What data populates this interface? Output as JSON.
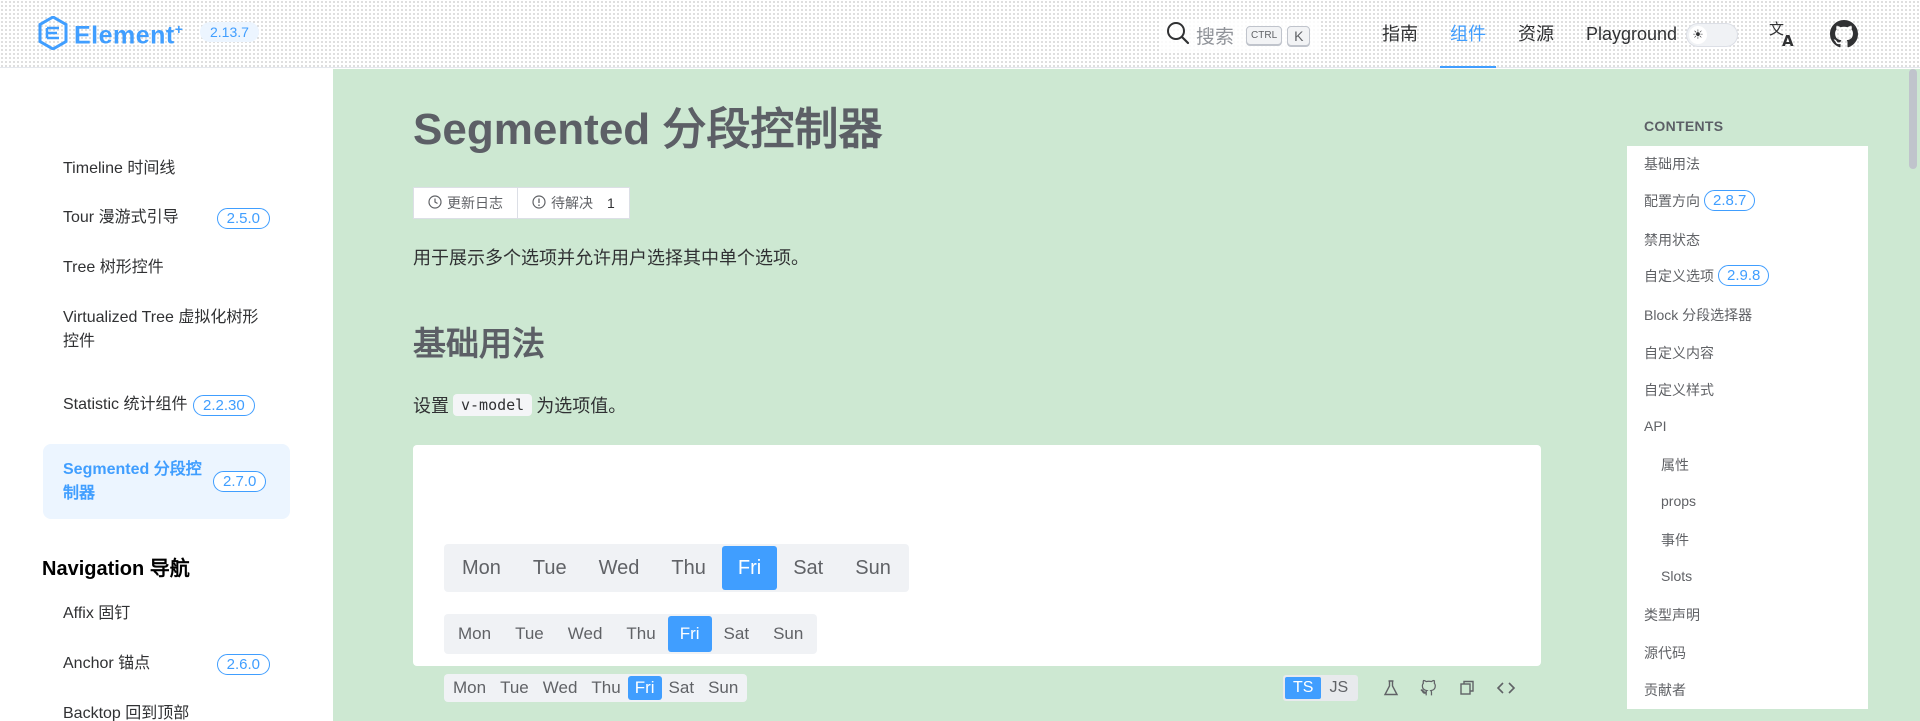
{
  "header": {
    "logo_text": "Element",
    "logo_plus": "+",
    "version": "2.13.7",
    "search_label": "搜索",
    "kbd_ctrl": "CTRL",
    "kbd_k": "K",
    "nav": [
      "指南",
      "组件",
      "资源",
      "Playground"
    ],
    "active_nav": "组件"
  },
  "sidebar": {
    "items": [
      {
        "label": "Timeline 时间线",
        "badge": ""
      },
      {
        "label": "Tour 漫游式引导",
        "badge": "2.5.0"
      },
      {
        "label": "Tree 树形控件",
        "badge": ""
      },
      {
        "label": "Virtualized Tree 虚拟化树形控件",
        "badge": ""
      },
      {
        "label": "Statistic 统计组件",
        "badge": "2.2.30"
      },
      {
        "label": "Segmented 分段控制器",
        "badge": "2.7.0",
        "active": true
      }
    ],
    "group_title": "Navigation 导航",
    "group_items": [
      {
        "label": "Affix 固钉",
        "badge": ""
      },
      {
        "label": "Anchor 锚点",
        "badge": "2.6.0"
      },
      {
        "label": "Backtop 回到顶部",
        "badge": ""
      }
    ]
  },
  "main": {
    "title": "Segmented 分段控制器",
    "changelog": "更新日志",
    "pending": "待解决",
    "pending_count": "1",
    "description": "用于展示多个选项并允许用户选择其中单个选项。",
    "section_title": "基础用法",
    "section_desc_pre": "设置",
    "section_desc_code": "v-model",
    "section_desc_post": "为选项值。",
    "segment_options": [
      "Mon",
      "Tue",
      "Wed",
      "Thu",
      "Fri",
      "Sat",
      "Sun"
    ],
    "selected": "Fri",
    "lang_ts": "TS",
    "lang_js": "JS"
  },
  "toc": {
    "heading": "CONTENTS",
    "items": [
      {
        "label": "基础用法",
        "badge": ""
      },
      {
        "label": "配置方向",
        "badge": "2.8.7"
      },
      {
        "label": "禁用状态",
        "badge": ""
      },
      {
        "label": "自定义选项",
        "badge": "2.9.8"
      },
      {
        "label": "Block 分段选择器",
        "badge": ""
      },
      {
        "label": "自定义内容",
        "badge": ""
      },
      {
        "label": "自定义样式",
        "badge": ""
      },
      {
        "label": "API",
        "badge": ""
      },
      {
        "label": "属性",
        "badge": "",
        "sub": true
      },
      {
        "label": "props",
        "badge": "",
        "sub": true
      },
      {
        "label": "事件",
        "badge": "",
        "sub": true
      },
      {
        "label": "Slots",
        "badge": "",
        "sub": true
      },
      {
        "label": "类型声明",
        "badge": ""
      },
      {
        "label": "源代码",
        "badge": ""
      },
      {
        "label": "贡献者",
        "badge": ""
      }
    ]
  },
  "colors": {
    "primary": "#409eff",
    "main_bg": "#cde8d2"
  },
  "icons": [
    "element-logo-icon",
    "search-icon",
    "sun-icon",
    "translate-icon",
    "github-icon",
    "clock-icon",
    "info-icon",
    "flask-icon",
    "copy-icon",
    "code-icon"
  ]
}
